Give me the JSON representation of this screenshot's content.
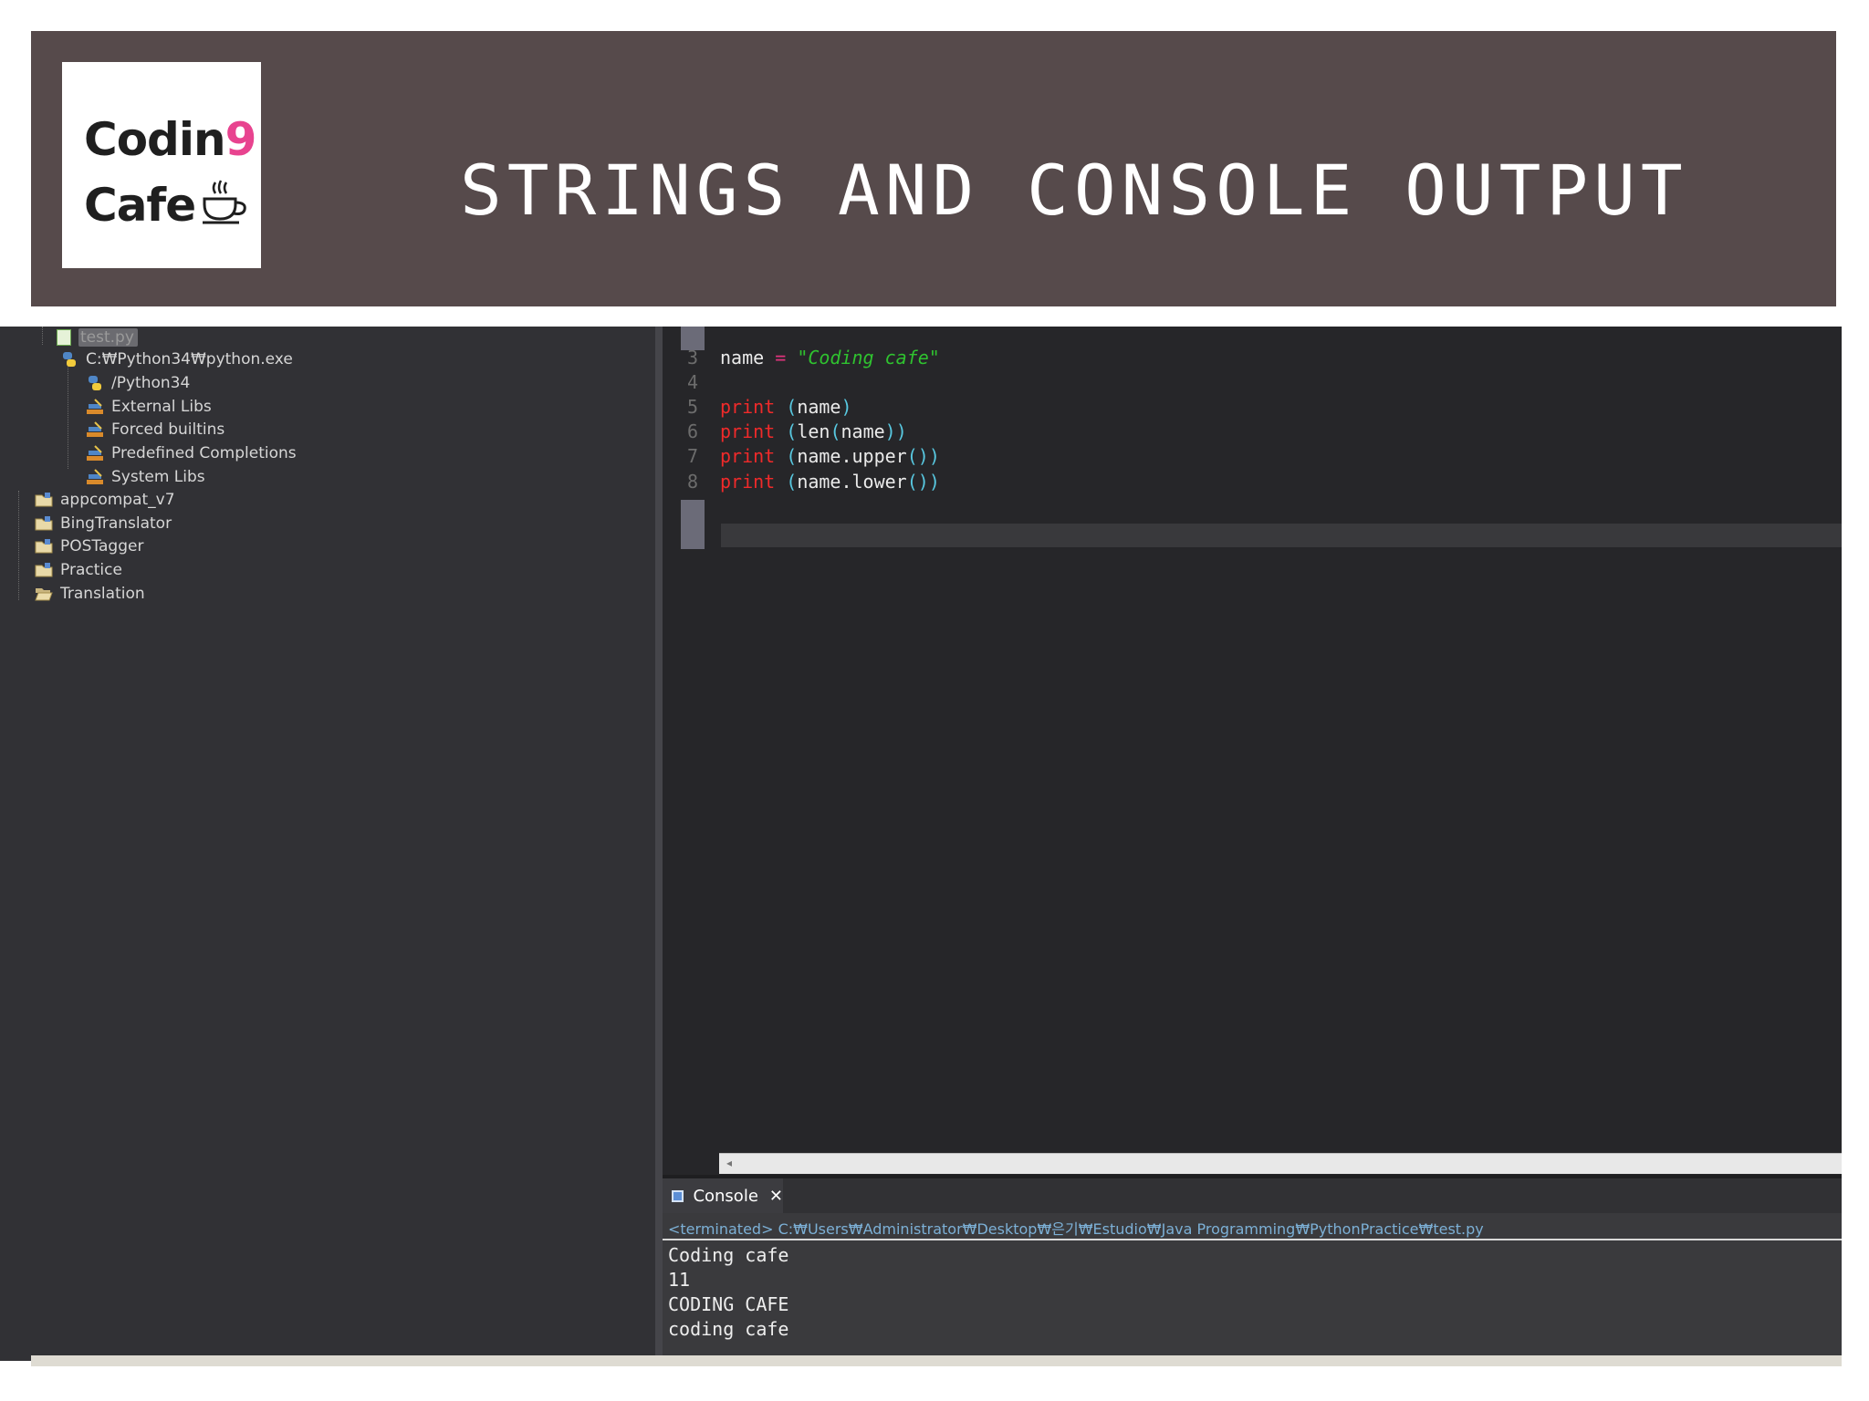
{
  "banner": {
    "logo_line1_main": "Codin",
    "logo_line1_accent": "9",
    "logo_line2": "Cafe",
    "title": "STRINGS AND CONSOLE OUTPUT"
  },
  "project_tree": {
    "items": [
      {
        "label": "test.py",
        "icon": "python-file-icon",
        "selected": true
      },
      {
        "label": "C:₩Python34₩python.exe",
        "icon": "python-interpreter-icon"
      },
      {
        "label": "/Python34",
        "icon": "python-folder-icon"
      },
      {
        "label": "External Libs",
        "icon": "library-icon"
      },
      {
        "label": "Forced builtins",
        "icon": "library-icon"
      },
      {
        "label": "Predefined Completions",
        "icon": "library-icon"
      },
      {
        "label": "System Libs",
        "icon": "library-icon"
      },
      {
        "label": "appcompat_v7",
        "icon": "project-folder-icon"
      },
      {
        "label": "BingTranslator",
        "icon": "project-folder-icon"
      },
      {
        "label": "POSTagger",
        "icon": "project-folder-icon"
      },
      {
        "label": "Practice",
        "icon": "project-folder-icon"
      },
      {
        "label": "Translation",
        "icon": "open-folder-icon"
      }
    ]
  },
  "editor": {
    "lines": [
      {
        "num": "3",
        "tokens": [
          [
            "id",
            "name"
          ],
          [
            "sp",
            " "
          ],
          [
            "op",
            "="
          ],
          [
            "sp",
            " "
          ],
          [
            "str",
            "\"Coding cafe\""
          ]
        ]
      },
      {
        "num": "4",
        "tokens": []
      },
      {
        "num": "5",
        "tokens": [
          [
            "kw",
            "print"
          ],
          [
            "sp",
            " "
          ],
          [
            "br",
            "("
          ],
          [
            "id",
            "name"
          ],
          [
            "br",
            ")"
          ]
        ]
      },
      {
        "num": "6",
        "tokens": [
          [
            "kw",
            "print"
          ],
          [
            "sp",
            " "
          ],
          [
            "br",
            "("
          ],
          [
            "id",
            "len"
          ],
          [
            "br",
            "("
          ],
          [
            "id",
            "name"
          ],
          [
            "br",
            "))"
          ]
        ]
      },
      {
        "num": "7",
        "tokens": [
          [
            "kw",
            "print"
          ],
          [
            "sp",
            " "
          ],
          [
            "br",
            "("
          ],
          [
            "id",
            "name.upper"
          ],
          [
            "br",
            "())"
          ]
        ]
      },
      {
        "num": "8",
        "tokens": [
          [
            "kw",
            "print"
          ],
          [
            "sp",
            " "
          ],
          [
            "br",
            "("
          ],
          [
            "id",
            "name.lower"
          ],
          [
            "br",
            "())"
          ]
        ]
      }
    ]
  },
  "console": {
    "tab_label": "Console",
    "path": "<terminated> C:₩Users₩Administrator₩Desktop₩은기₩Estudio₩Java Programming₩PythonPractice₩test.py",
    "output": [
      "Coding cafe",
      "11",
      "CODING CAFE",
      "coding cafe"
    ]
  },
  "colors": {
    "banner": "#564a4b",
    "keyword": "#f02a2a",
    "string": "#2fc22f",
    "operator": "#e0337d",
    "bracket": "#58c8e0",
    "logo_accent": "#e8438f"
  }
}
